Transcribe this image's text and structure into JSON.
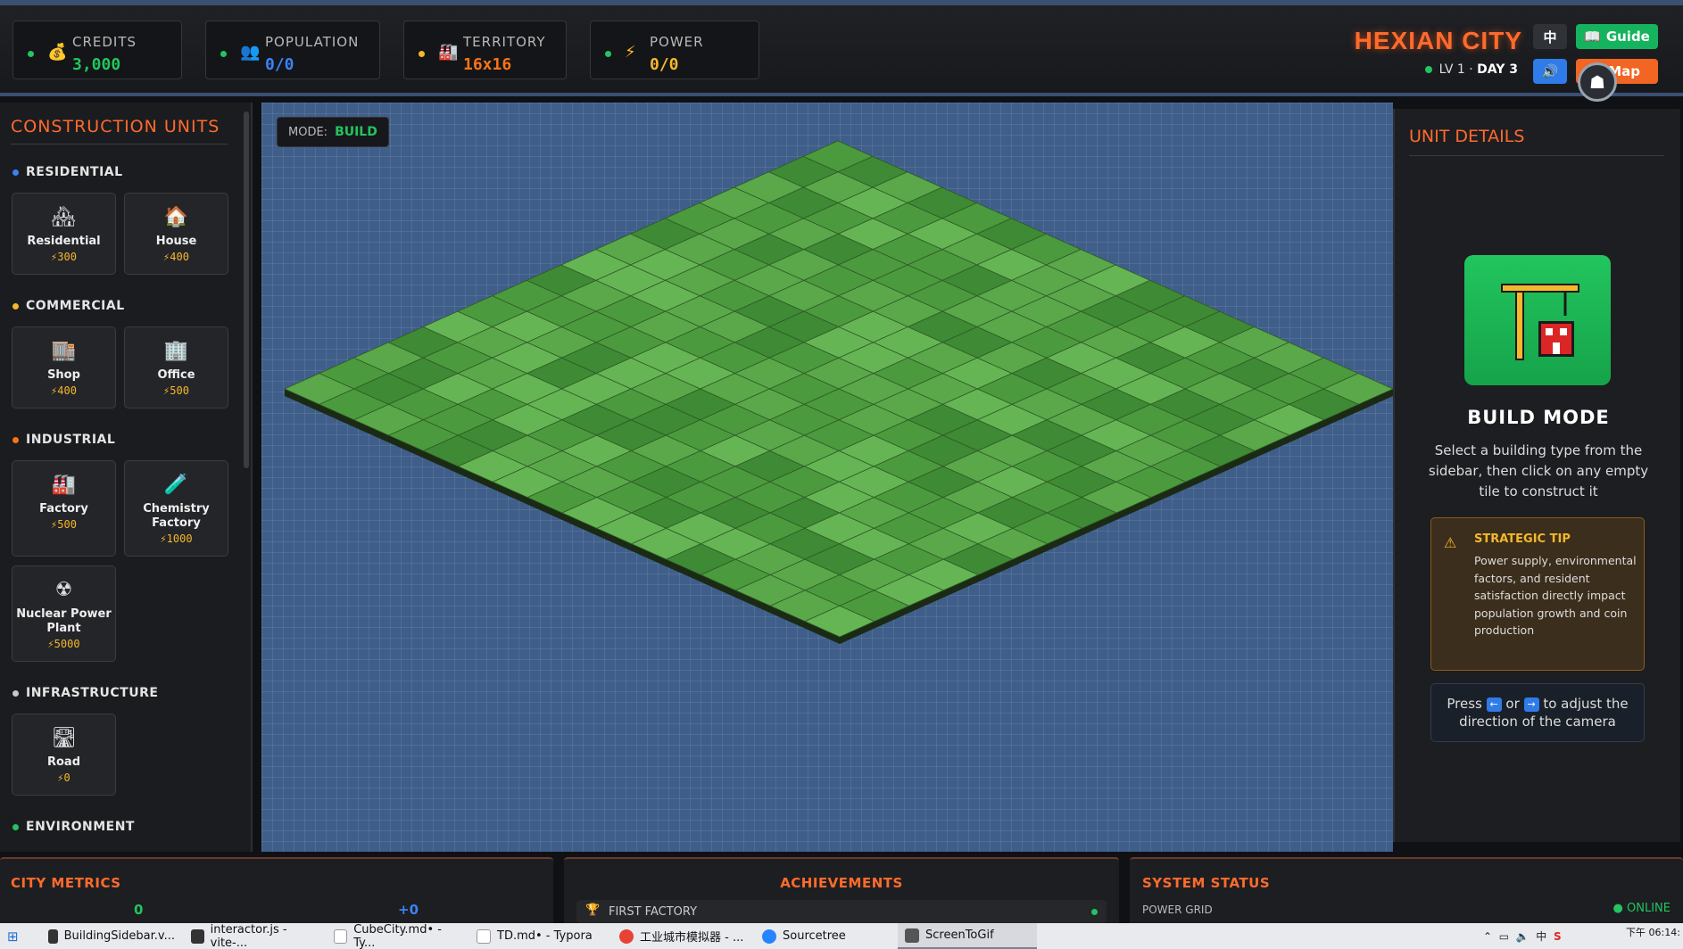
{
  "stats": [
    {
      "label": "CREDITS",
      "value": "3,000",
      "icon": "money-bag-icon",
      "color": "#22c55e"
    },
    {
      "label": "POPULATION",
      "value": "0/0",
      "icon": "people-icon",
      "color": "#3b82f6"
    },
    {
      "label": "TERRITORY",
      "value": "16x16",
      "icon": "factory-icon",
      "color": "#f97316"
    },
    {
      "label": "POWER",
      "value": "0/0",
      "icon": "lightning-icon",
      "color": "#f5b82a"
    }
  ],
  "header": {
    "title": "HEXIAN CITY",
    "level": "LV 1",
    "day": "DAY 3",
    "lang_button": "中",
    "guide_button": "Guide",
    "map_button": "Map"
  },
  "sidebar": {
    "title": "CONSTRUCTION UNITS",
    "categories": [
      {
        "name": "RESIDENTIAL",
        "color": "#3b82f6"
      },
      {
        "name": "COMMERCIAL",
        "color": "#f5b82a"
      },
      {
        "name": "INDUSTRIAL",
        "color": "#f97316"
      },
      {
        "name": "INFRASTRUCTURE",
        "color": "#c8c8c8"
      },
      {
        "name": "ENVIRONMENT",
        "color": "#22c55e"
      }
    ],
    "units": [
      {
        "name": "Residential",
        "cost": "300",
        "icon": "residential-icon"
      },
      {
        "name": "House",
        "cost": "400",
        "icon": "house-icon"
      },
      {
        "name": "Shop",
        "cost": "400",
        "icon": "shop-icon"
      },
      {
        "name": "Office",
        "cost": "500",
        "icon": "office-icon"
      },
      {
        "name": "Factory",
        "cost": "500",
        "icon": "factory-icon"
      },
      {
        "name": "Chemistry Factory",
        "cost": "1000",
        "icon": "test-tube-icon"
      },
      {
        "name": "Nuclear Power Plant",
        "cost": "5000",
        "icon": "radiation-icon"
      },
      {
        "name": "Road",
        "cost": "0",
        "icon": "road-icon"
      }
    ]
  },
  "mode": {
    "label": "MODE:",
    "value": "BUILD"
  },
  "map": {
    "grid_size": 16,
    "tile_colors": [
      "#5aa84a",
      "#4c9a3e",
      "#3f8a34",
      "#66b554"
    ]
  },
  "details": {
    "title": "UNIT DETAILS",
    "mode_title": "BUILD MODE",
    "description": "Select a building type from the sidebar, then click on any empty tile to construct it",
    "tip_title": "STRATEGIC TIP",
    "tip_body": "Power supply, environmental factors, and resident satisfaction directly impact population growth and coin production",
    "camera_press": "Press",
    "camera_or": "or",
    "camera_rest": "to adjust the direction of the camera",
    "key_left": "←",
    "key_right": "→"
  },
  "bottom": {
    "metrics_title": "CITY METRICS",
    "metrics_values": [
      "0",
      "+0"
    ],
    "achievements_title": "ACHIEVEMENTS",
    "achievement_first": "FIRST FACTORY",
    "status_title": "SYSTEM STATUS",
    "status_row": "POWER GRID",
    "status_value": "ONLINE"
  },
  "taskbar": {
    "items": [
      "BuildingSidebar.v...",
      "interactor.js - vite-...",
      "CubeCity.md• - Ty...",
      "TD.md• - Typora",
      "工业城市模拟器 - ...",
      "Sourcetree",
      "ScreenToGif"
    ],
    "tray_lang": "中",
    "clock": "下午 06:14:"
  }
}
